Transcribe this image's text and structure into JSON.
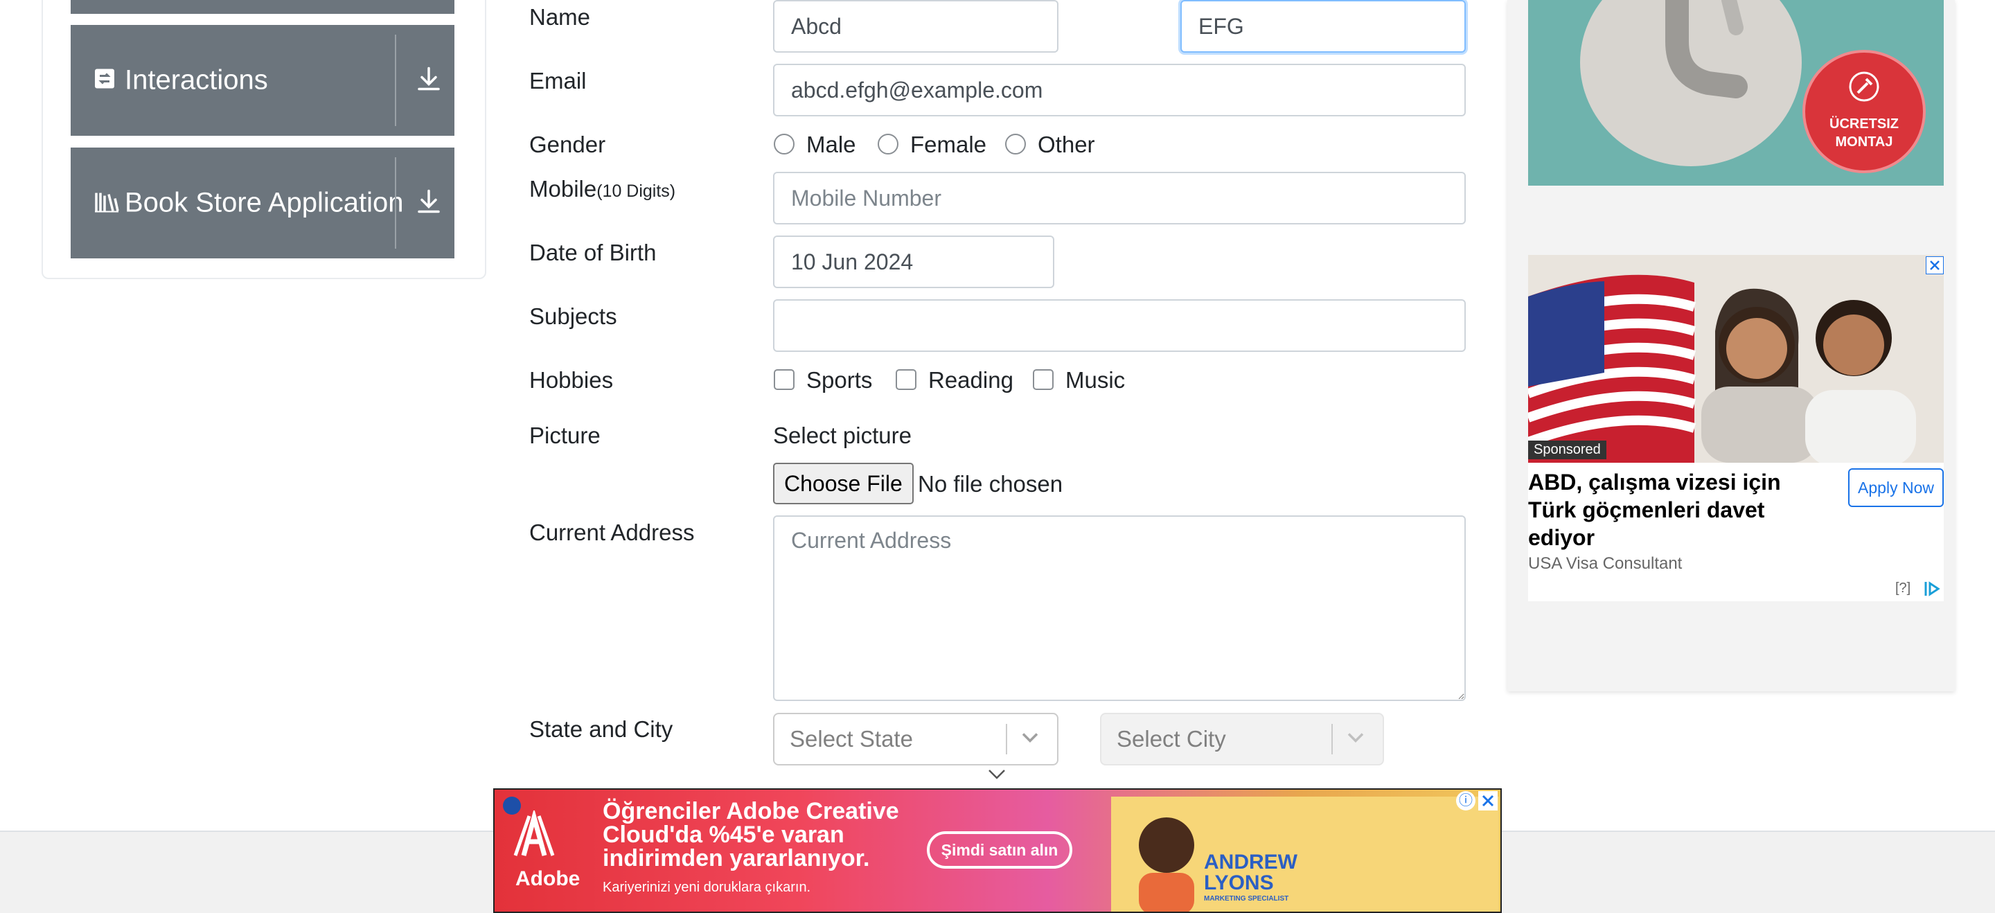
{
  "sidebar": {
    "items": [
      {
        "label": "Interactions",
        "icon": "interactions-icon"
      },
      {
        "label": "Book Store Application",
        "icon": "books-icon"
      }
    ]
  },
  "form": {
    "name_label": "Name",
    "first_name": "Abcd",
    "last_name": "EFG",
    "email_label": "Email",
    "email": "abcd.efgh@example.com",
    "gender_label": "Gender",
    "gender_options": [
      "Male",
      "Female",
      "Other"
    ],
    "mobile_label": "Mobile",
    "mobile_hint": "(10 Digits)",
    "mobile_placeholder": "Mobile Number",
    "dob_label": "Date of Birth",
    "dob": "10 Jun 2024",
    "subjects_label": "Subjects",
    "hobbies_label": "Hobbies",
    "hobbies": [
      "Sports",
      "Reading",
      "Music"
    ],
    "picture_label": "Picture",
    "picture_prompt": "Select picture",
    "choose_file": "Choose File",
    "no_file": "No file chosen",
    "address_label": "Current Address",
    "address_placeholder": "Current Address",
    "state_city_label": "State and City",
    "state_placeholder": "Select State",
    "city_placeholder": "Select City"
  },
  "right_ad": {
    "montaj_line1": "ÜCRETSIZ",
    "montaj_line2": "MONTAJ",
    "sponsored": "Sponsored",
    "headline": "ABD, çalışma vizesi için Türk göçmenleri davet ediyor",
    "source": "USA Visa Consultant",
    "cta": "Apply Now",
    "help": "[?]"
  },
  "bottom_ad": {
    "brand": "Adobe",
    "headline": "Öğrenciler Adobe Creative Cloud'da %45'e varan indirimden yararlanıyor.",
    "subline": "Kariyerinizi yeni doruklara çıkarın.",
    "cta": "Şimdi satın alın",
    "person_name": "ANDREW LYONS",
    "person_title": "MARKETING SPECIALIST"
  },
  "colors": {
    "sidebar_item": "#6c757d",
    "ad_teal": "#6fb3ad",
    "ad_red": "#d9343a",
    "link_blue": "#1a73e8"
  }
}
